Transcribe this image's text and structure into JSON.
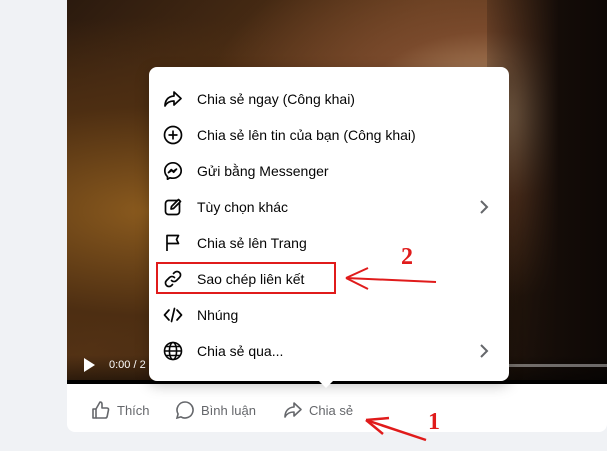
{
  "video": {
    "time": "0:00 / 2"
  },
  "actions": {
    "like": "Thích",
    "comment": "Bình luận",
    "share": "Chia sẻ"
  },
  "share_menu": {
    "items": [
      {
        "label": "Chia sẻ ngay (Công khai)",
        "icon": "share-arrow-icon"
      },
      {
        "label": "Chia sẻ lên tin của bạn (Công khai)",
        "icon": "plus-circle-icon"
      },
      {
        "label": "Gửi bằng Messenger",
        "icon": "messenger-icon"
      },
      {
        "label": "Tùy chọn khác",
        "icon": "edit-icon",
        "has_submenu": true
      },
      {
        "label": "Chia sẻ lên Trang",
        "icon": "flag-icon"
      },
      {
        "label": "Sao chép liên kết",
        "icon": "link-icon"
      },
      {
        "label": "Nhúng",
        "icon": "code-icon"
      },
      {
        "label": "Chia sẻ qua...",
        "icon": "globe-icon",
        "has_submenu": true
      }
    ]
  },
  "annotations": {
    "step1": "1",
    "step2": "2",
    "color": "#e01b1b"
  }
}
